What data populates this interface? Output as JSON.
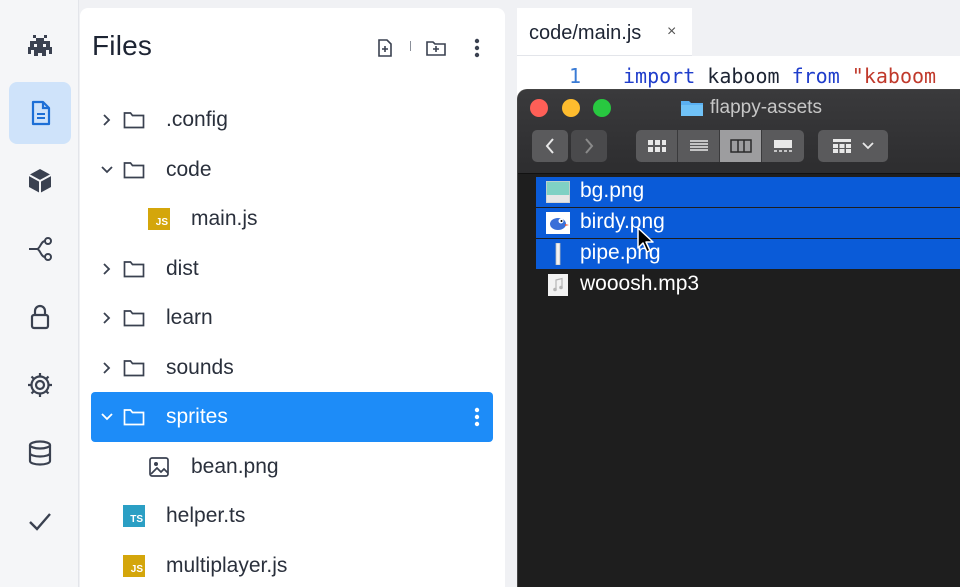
{
  "sidebar": {
    "items": [
      {
        "name": "space-invader-icon"
      },
      {
        "name": "file-icon",
        "active": true
      },
      {
        "name": "package-icon"
      },
      {
        "name": "git-branch-icon"
      },
      {
        "name": "lock-icon"
      },
      {
        "name": "gear-icon"
      },
      {
        "name": "database-icon"
      },
      {
        "name": "checkmark-icon"
      }
    ]
  },
  "files": {
    "title": "Files",
    "actions": [
      "new-file-icon",
      "new-folder-icon",
      "kebab-menu-icon"
    ],
    "tree": [
      {
        "label": ".config",
        "type": "folder",
        "expanded": false,
        "depth": 0
      },
      {
        "label": "code",
        "type": "folder",
        "expanded": true,
        "depth": 0
      },
      {
        "label": "main.js",
        "type": "js",
        "depth": 1
      },
      {
        "label": "dist",
        "type": "folder",
        "expanded": false,
        "depth": 0
      },
      {
        "label": "learn",
        "type": "folder",
        "expanded": false,
        "depth": 0
      },
      {
        "label": "sounds",
        "type": "folder",
        "expanded": false,
        "depth": 0
      },
      {
        "label": "sprites",
        "type": "folder",
        "expanded": true,
        "depth": 0,
        "selected": true
      },
      {
        "label": "bean.png",
        "type": "image",
        "depth": 1
      },
      {
        "label": "helper.ts",
        "type": "ts",
        "depth": 0
      },
      {
        "label": "multiplayer.js",
        "type": "js",
        "depth": 0
      }
    ],
    "badges": {
      "js": "JS",
      "ts": "TS"
    }
  },
  "editor": {
    "tab": {
      "label": "code/main.js",
      "close": "×"
    },
    "line_number": "1",
    "code": {
      "kw1": "import",
      "ident": " kaboom ",
      "kw2": "from",
      "str": " \"kaboom"
    }
  },
  "finder": {
    "title": "flappy-assets",
    "view_modes": [
      "icon-view",
      "list-view",
      "column-view",
      "gallery-view"
    ],
    "active_view": "column-view",
    "files": [
      {
        "name": "bg.png",
        "selected": true
      },
      {
        "name": "birdy.png",
        "selected": true
      },
      {
        "name": "pipe.png",
        "selected": true
      },
      {
        "name": "wooosh.mp3",
        "selected": false
      }
    ]
  },
  "colors": {
    "accent": "#1d8cf8",
    "finder_selection": "#0a5bd8",
    "js_badge": "#d4a60b",
    "ts_badge": "#2b9fc4"
  }
}
